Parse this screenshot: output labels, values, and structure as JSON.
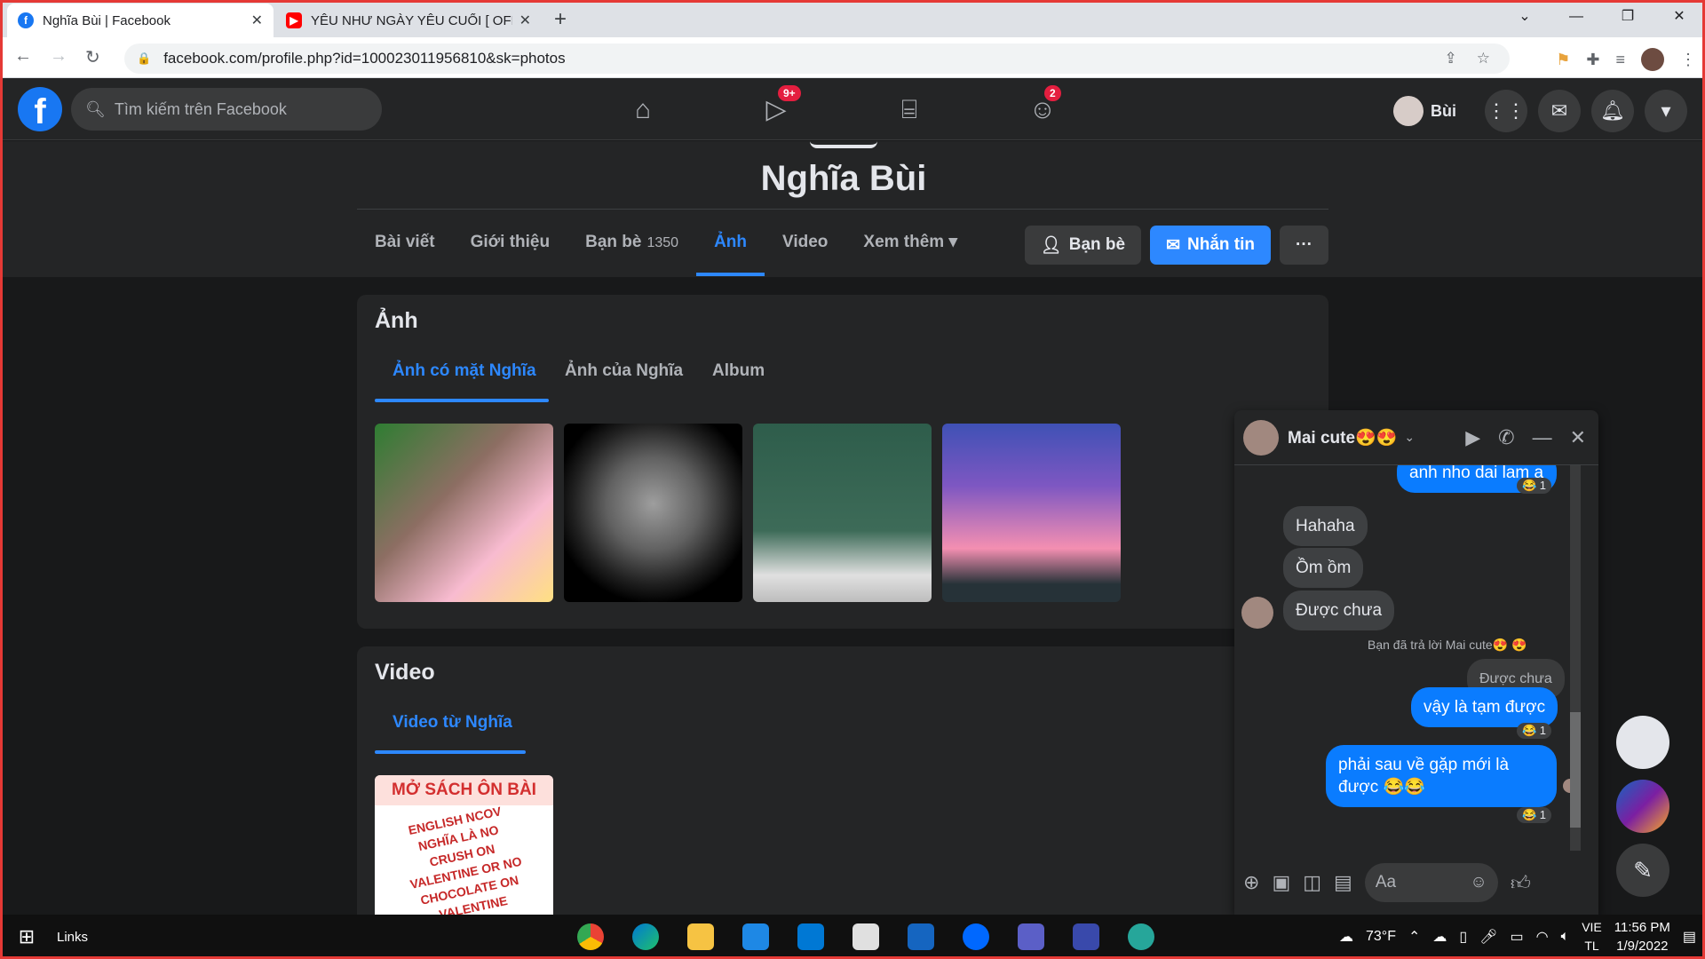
{
  "browser": {
    "tabs": [
      {
        "title": "Nghĩa Bùi | Facebook",
        "icon": "facebook-icon",
        "color": "#1877f2"
      },
      {
        "title": "YÊU NHƯ NGÀY YÊU CUỐI [ OFFI",
        "icon": "youtube-icon",
        "color": "#ff0000"
      }
    ],
    "url": "facebook.com/profile.php?id=100023011956810&sk=photos"
  },
  "fb_header": {
    "search_placeholder": "Tìm kiếm trên Facebook",
    "watch_badge": "9+",
    "groups_badge": "2",
    "user_short_name": "Bùi"
  },
  "profile": {
    "name": "Nghĩa Bùi",
    "tabs": [
      {
        "label": "Bài viết"
      },
      {
        "label": "Giới thiệu"
      },
      {
        "label": "Bạn bè",
        "count": "1350"
      },
      {
        "label": "Ảnh"
      },
      {
        "label": "Video"
      },
      {
        "label": "Xem thêm ▾"
      }
    ],
    "buttons": {
      "friends": "Bạn bè",
      "message": "Nhắn tin",
      "more": "···"
    }
  },
  "photos_section": {
    "title": "Ảnh",
    "subtabs": [
      "Ảnh có mặt Nghĩa",
      "Ảnh của Nghĩa",
      "Album"
    ]
  },
  "video_section": {
    "title": "Video",
    "subtab": "Video từ Nghĩa",
    "thumb_text": "MỞ SÁCH ÔN BÀI",
    "thumb_sub": "ENGLISH NCOV NGHĨA LÀ NO CRUSH ON VALENTINE OR NO CHOCOLATE ON VALENTINE"
  },
  "chat": {
    "name": "Mai cute😍😍",
    "messages": {
      "m1": "anh nho dai lam a",
      "m2": "Hahaha",
      "m3": "Ồm ồm",
      "m4": "Được chưa",
      "reply_note": "Bạn đã trả lời Mai cute😍 😍",
      "quoted": "Được chưa",
      "m5": "vậy là tạm được",
      "m6": "phải sau về gặp mới là được 😂😂",
      "reaction": "😂 1"
    },
    "input_placeholder": "Aa"
  },
  "taskbar": {
    "links": "Links",
    "temp": "73°F",
    "lang1": "VIE",
    "lang2": "TL",
    "time": "11:56 PM",
    "date": "1/9/2022"
  }
}
